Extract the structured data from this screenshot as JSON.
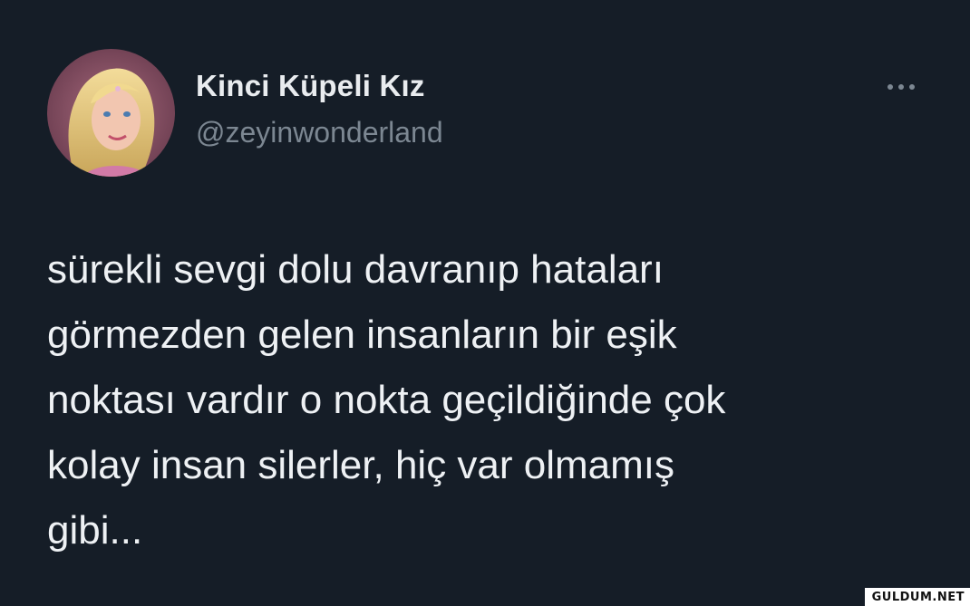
{
  "tweet": {
    "display_name": "Kinci Küpeli Kız",
    "handle": "@zeyinwonderland",
    "text": "sürekli sevgi dolu davranıp hataları\ngörmezden gelen insanların bir eşik\nnoktası vardır o nokta geçildiğinde çok\nkolay insan silerler, hiç var olmamış\ngibi...",
    "more_icon": "more-horizontal-icon"
  },
  "watermark": "GULDUM.NET",
  "colors": {
    "background": "#151d27",
    "text": "#eef1f4",
    "handle": "#7c8792"
  }
}
